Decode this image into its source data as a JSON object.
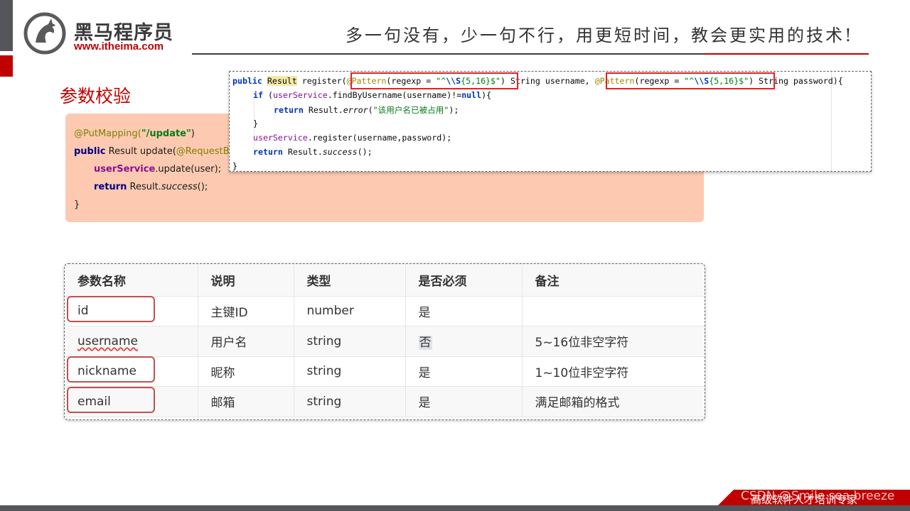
{
  "header": {
    "logo_cn": "黑马程序员",
    "logo_url": "www.itheima.com",
    "slogan": "多一句没有，少一句不行，用更短时间，教会更实用的技术!"
  },
  "section_title": "参数校验",
  "update_code": {
    "annotation": "@PutMapping(",
    "path": "\"/update\"",
    "close_paren": ")",
    "kw_public": "public",
    "signature": " Result update(",
    "param_annotation": "@RequestBo",
    "service_field": "userService",
    "service_call": ".update(user);",
    "kw_return": "return",
    "result_prefix": " Result.",
    "success_method": "success",
    "call_end": "();",
    "closing_brace": "}"
  },
  "register_code": {
    "l1_kw": "public",
    "l1_type": "Result",
    "l1_method": " register(",
    "ann_pattern": "@Pattern",
    "regexp_open": "(regexp = ",
    "regex_quote_open": "\"^",
    "regex_escape": "\\\\S",
    "regex_mid": "{5,16}",
    "regex_quote_close": "$\"",
    "regexp_close": ")",
    "param1": " String username, ",
    "param2": " String password){",
    "l2_kw": "if",
    "l2_open": " (",
    "l2_field": "userService",
    "l2_rest": ".findByUsername(username)!=",
    "l2_null": "null",
    "l2_end": "){",
    "l3_kw": "return",
    "l3_result": " Result.",
    "l3_method": "error",
    "l3_open": "(",
    "l3_str": "\"该用户名已被占用\"",
    "l3_end": ");",
    "l4": "}",
    "l5_field": "userService",
    "l5_rest": ".register(username,password);",
    "l6_kw": "return",
    "l6_result": " Result.",
    "l6_method": "success",
    "l6_end": "();",
    "l7": "}"
  },
  "params_table": {
    "headers": [
      "参数名称",
      "说明",
      "类型",
      "是否必须",
      "备注"
    ],
    "rows": [
      [
        "id",
        "主键ID",
        "number",
        "是",
        ""
      ],
      [
        "username",
        "用户名",
        "string",
        "否",
        "5~16位非空字符"
      ],
      [
        "nickname",
        "昵称",
        "string",
        "是",
        "1~10位非空字符"
      ],
      [
        "email",
        "邮箱",
        "string",
        "是",
        "满足邮箱的格式"
      ]
    ]
  },
  "footer": {
    "text": "高级软件人才培训专家",
    "watermark": "CSDN @Smile sea breeze"
  },
  "colors": {
    "brand_red": "#c00000",
    "dark_gray": "#54565a",
    "peach_bg": "#fdcab1",
    "highlight_box": "#e0212a"
  }
}
